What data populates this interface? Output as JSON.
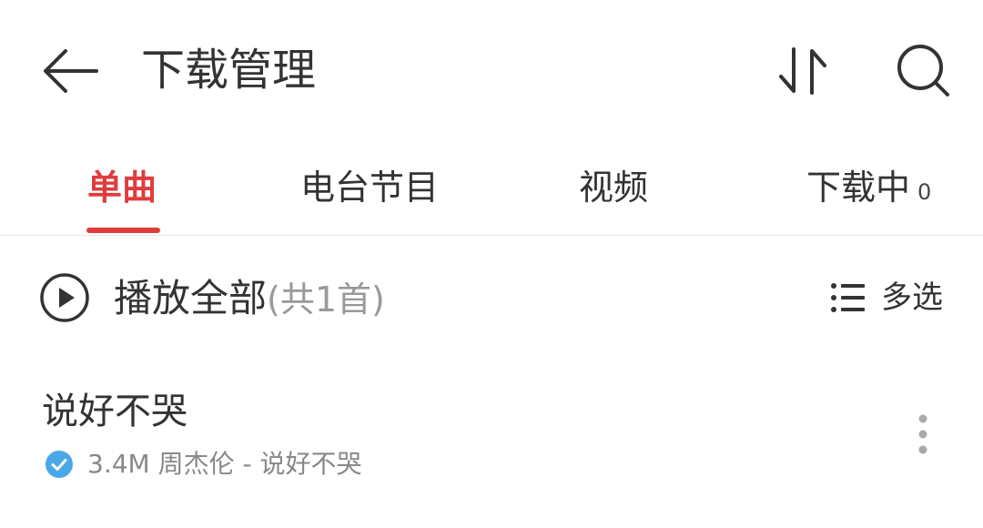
{
  "header": {
    "title": "下载管理",
    "back_icon": "arrow-left-icon",
    "sort_icon": "sort-arrows-icon",
    "search_icon": "search-icon"
  },
  "tabs": [
    {
      "label": "单曲",
      "active": true
    },
    {
      "label": "电台节目",
      "active": false
    },
    {
      "label": "视频",
      "active": false
    },
    {
      "label": "下载中",
      "count": "0",
      "active": false
    }
  ],
  "play_all": {
    "label": "播放全部",
    "count_text": "(共1首)",
    "icon": "play-circle-icon"
  },
  "multiselect": {
    "label": "多选",
    "icon": "list-icon"
  },
  "songs": [
    {
      "title": "说好不哭",
      "meta": "3.4M 周杰伦 - 说好不哭",
      "status_icon": "check-circle-icon",
      "more_icon": "more-vertical-icon"
    }
  ],
  "colors": {
    "accent": "#e03c3c",
    "downloaded": "#4aa8e8",
    "text_primary": "#333333",
    "text_secondary": "#888888"
  }
}
